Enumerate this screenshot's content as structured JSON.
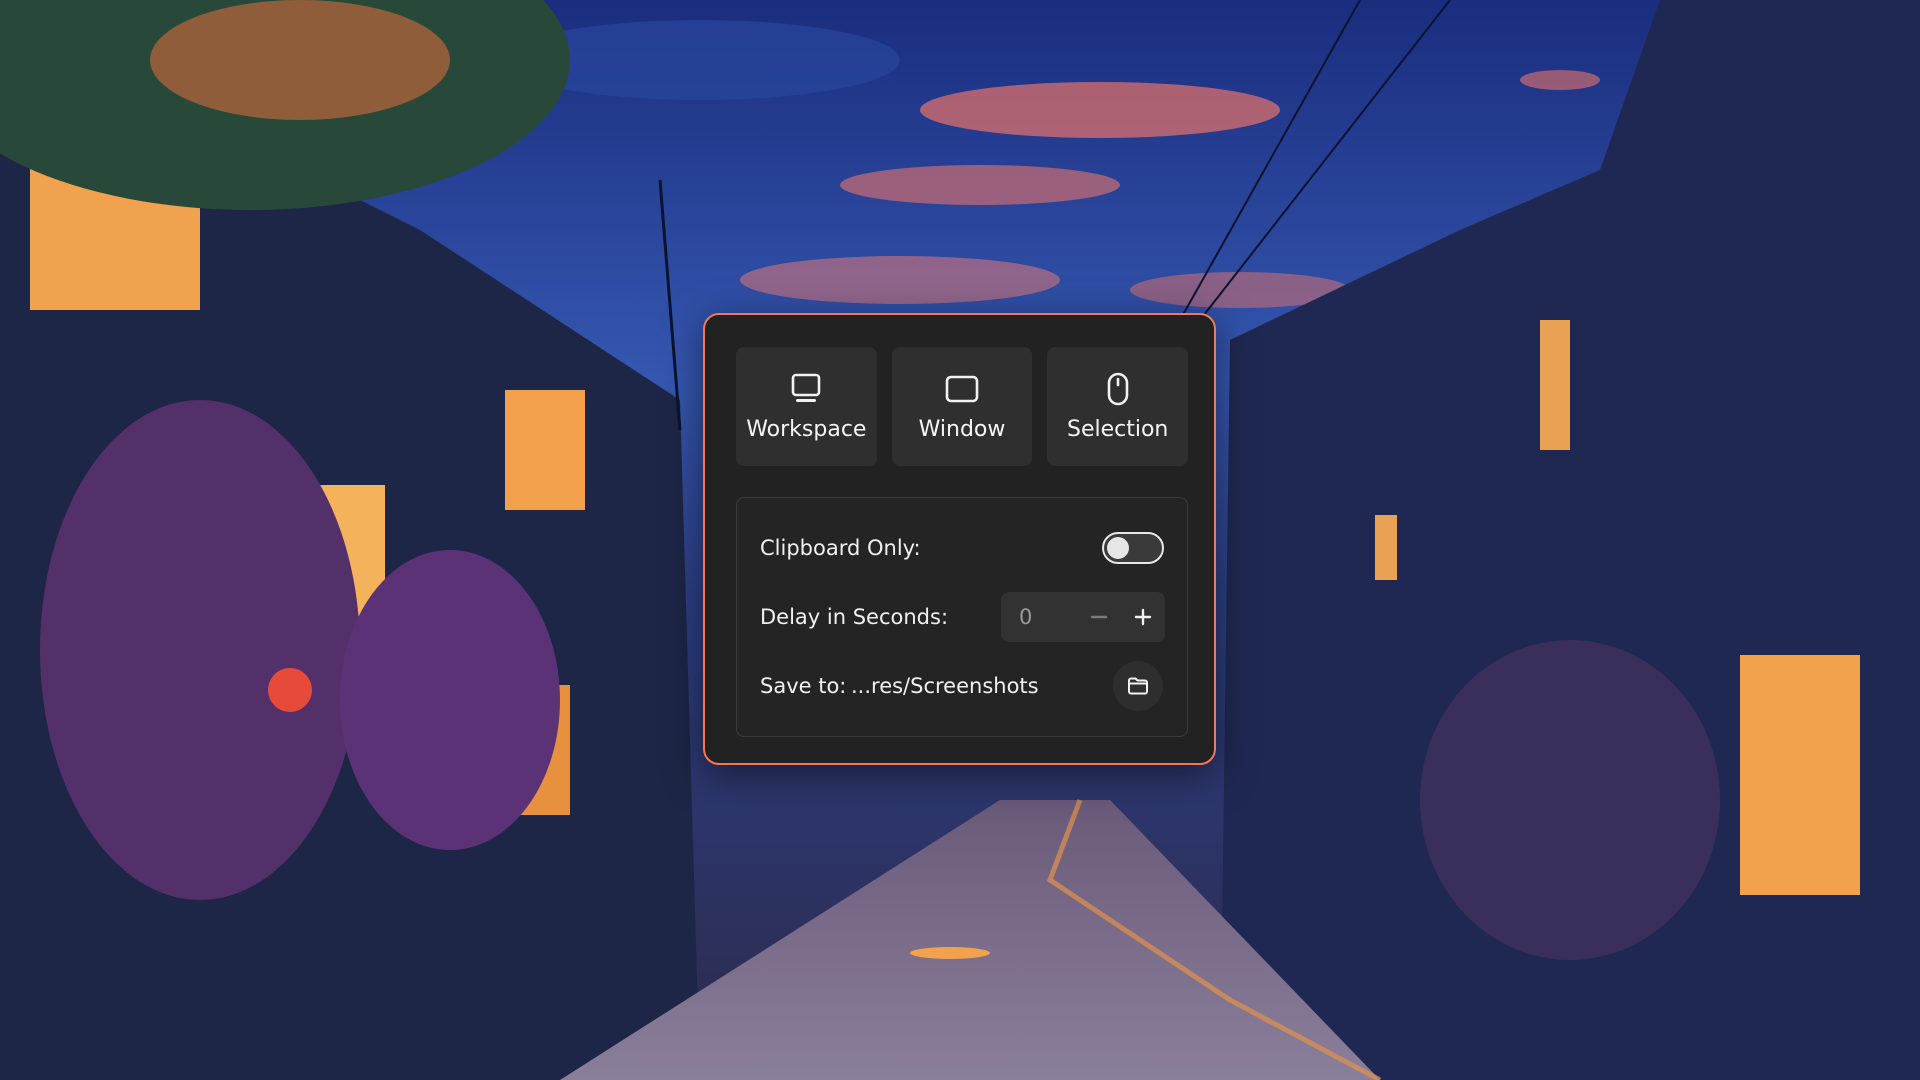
{
  "wallpaper": {
    "description_icon": "night-street-wallpaper"
  },
  "dialog": {
    "accent_color": "#f2785a",
    "modes": [
      {
        "label": "Workspace",
        "icon": "monitor-icon"
      },
      {
        "label": "Window",
        "icon": "window-icon"
      },
      {
        "label": "Selection",
        "icon": "mouse-icon"
      }
    ],
    "options": {
      "clipboard_label": "Clipboard Only:",
      "clipboard_enabled": false,
      "delay_label": "Delay in Seconds:",
      "delay_value": "0",
      "save_label": "Save to:",
      "save_path": "...res/Screenshots",
      "folder_icon": "folder-icon"
    }
  }
}
